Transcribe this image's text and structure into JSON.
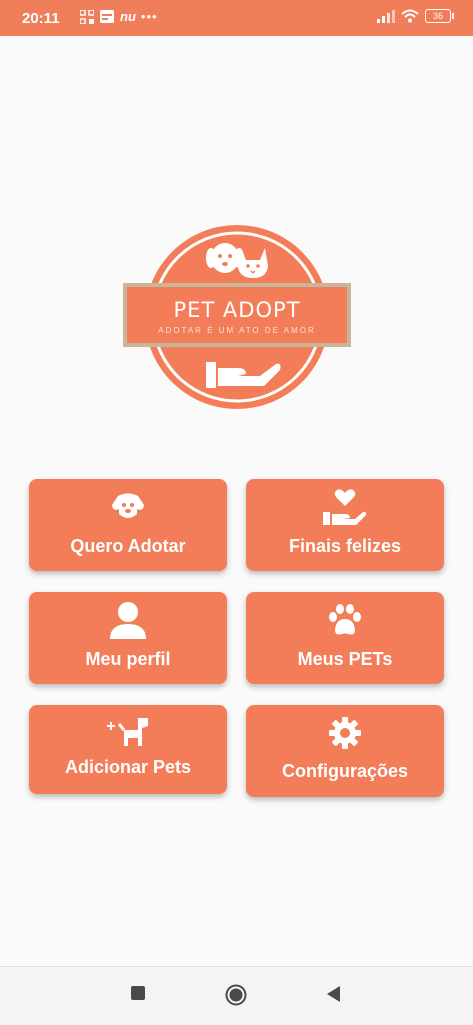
{
  "status_bar": {
    "time": "20:11",
    "app_badge": "nu",
    "more": "•••",
    "battery": "36"
  },
  "logo": {
    "title": "PET ADOPT",
    "tagline": "ADOTAR É UM ATO DE AMOR"
  },
  "menu": {
    "quero_adotar": "Quero Adotar",
    "finais_felizes": "Finais felizes",
    "meu_perfil": "Meu perfil",
    "meus_pets": "Meus PETs",
    "adicionar_pets": "Adicionar Pets",
    "configuracoes": "Configurações"
  },
  "colors": {
    "accent": "#f27d58",
    "status_bar": "#f07e5a",
    "background": "#fafafa"
  },
  "icons": {
    "quero_adotar": "dog-face-icon",
    "finais_felizes": "heart-hand-icon",
    "meu_perfil": "user-icon",
    "meus_pets": "paw-icon",
    "adicionar_pets": "add-dog-icon",
    "configuracoes": "gear-icon"
  }
}
